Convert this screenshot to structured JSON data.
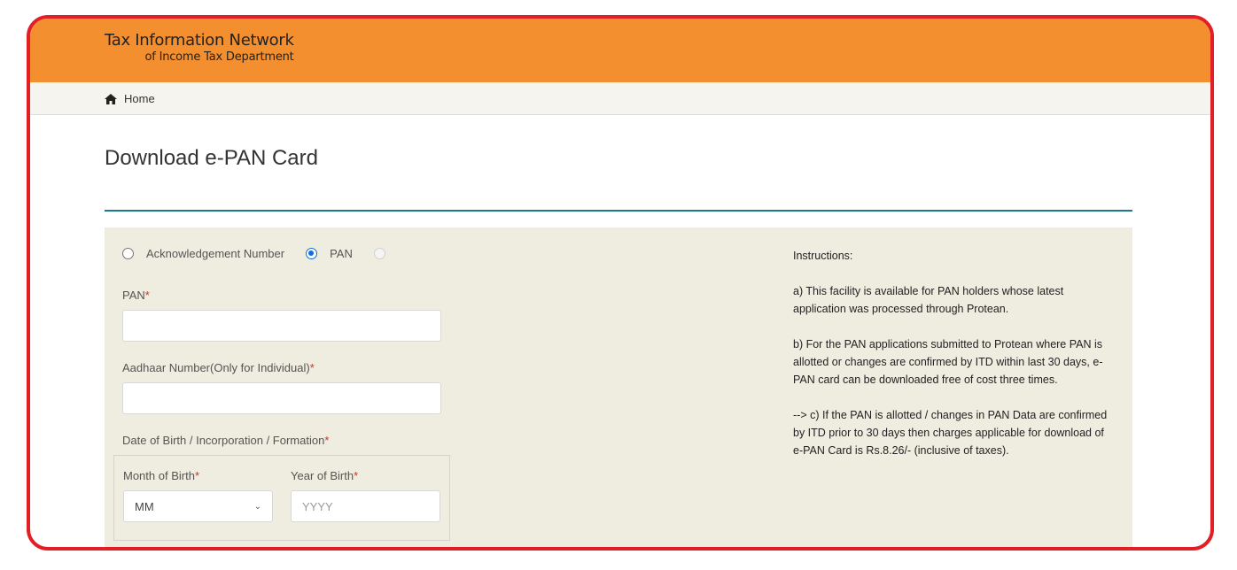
{
  "header": {
    "brand_line1": "Tax Information Network",
    "brand_line2": "of Income Tax Department",
    "brand_color": "#f48f2f"
  },
  "breadcrumb": {
    "icon": "home-icon",
    "home_label": "Home"
  },
  "page": {
    "title": "Download e-PAN Card",
    "accent_color": "#1a7a8a"
  },
  "form": {
    "radio_options": [
      {
        "label": "Acknowledgement Number",
        "checked": false
      },
      {
        "label": "PAN",
        "checked": true
      },
      {
        "label": "",
        "checked": false,
        "disabled": true
      }
    ],
    "pan": {
      "label": "PAN",
      "required_mark": "*",
      "value": "",
      "placeholder": ""
    },
    "aadhaar": {
      "label": "Aadhaar Number(Only for Individual)",
      "required_mark": "*",
      "value": "",
      "placeholder": ""
    },
    "dob": {
      "label": "Date of Birth / Incorporation / Formation",
      "required_mark": "*",
      "month": {
        "label": "Month of Birth",
        "required_mark": "*",
        "selected": "MM"
      },
      "year": {
        "label": "Year of Birth",
        "required_mark": "*",
        "value": "",
        "placeholder": "YYYY"
      }
    }
  },
  "instructions": {
    "heading": "Instructions:",
    "items": [
      "a) This facility is available for PAN holders whose latest application was processed through Protean.",
      "b) For the PAN applications submitted to Protean where PAN is allotted or changes are confirmed by ITD within last 30 days, e-PAN card can be downloaded free of cost three times.",
      "--> c) If the PAN is allotted / changes in PAN Data are confirmed by ITD prior to 30 days then charges applicable for download of e-PAN Card is Rs.8.26/- (inclusive of taxes)."
    ]
  }
}
